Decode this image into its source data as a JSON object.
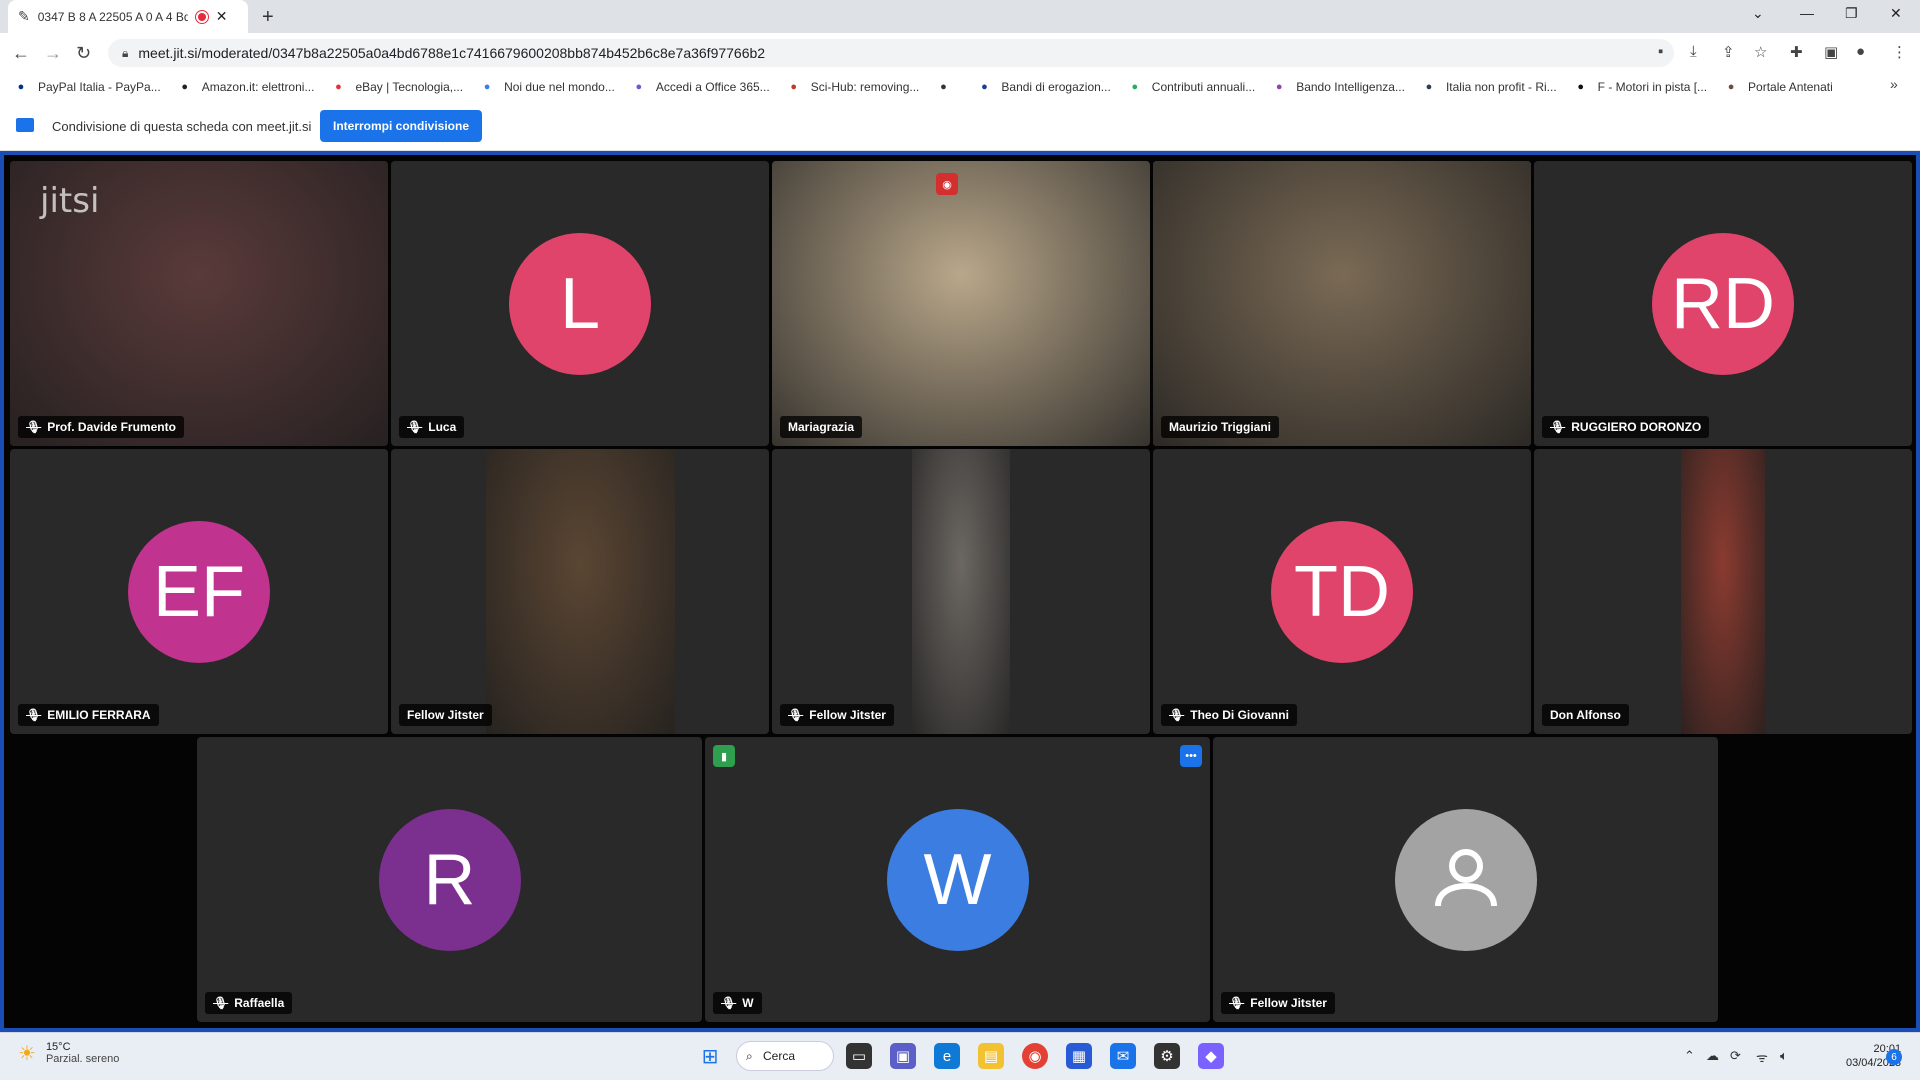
{
  "browser": {
    "tab_title": "0347 B 8 A 22505 A 0 A 4 Bd",
    "new_tab_label": "+",
    "url": "meet.jit.si/moderated/0347b8a22505a0a4bd6788e1c7416679600208bb874b452b6c8e7a36f97766b2",
    "bookmarks": [
      {
        "label": "PayPal Italia - PayPa...",
        "icon": "paypal-icon",
        "color": "#003087"
      },
      {
        "label": "Amazon.it: elettroni...",
        "icon": "amazon-icon",
        "color": "#222"
      },
      {
        "label": "eBay | Tecnologia,...",
        "icon": "ebay-icon",
        "color": "#e53238"
      },
      {
        "label": "Noi due nel mondo...",
        "icon": "blog-icon",
        "color": "#3b7de9"
      },
      {
        "label": "Accedi a Office 365...",
        "icon": "office-icon",
        "color": "#6a5acd"
      },
      {
        "label": "Sci-Hub: removing...",
        "icon": "scihub-icon",
        "color": "#c0392b"
      },
      {
        "label": "",
        "icon": "globe-icon",
        "color": "#333"
      },
      {
        "label": "Bandi di erogazion...",
        "icon": "doc-icon",
        "color": "#1f3a93"
      },
      {
        "label": "Contributi annuali...",
        "icon": "circle-icon",
        "color": "#27ae60"
      },
      {
        "label": "Bando Intelligenza...",
        "icon": "dots-icon",
        "color": "#8e44ad"
      },
      {
        "label": "Italia non profit - Ri...",
        "icon": "star-icon",
        "color": "#2c3e50"
      },
      {
        "label": "F - Motori in pista [...",
        "icon": "flag-icon",
        "color": "#111"
      },
      {
        "label": "Portale Antenati",
        "icon": "tree-icon",
        "color": "#6d4c41"
      }
    ],
    "more_bookmarks": "»"
  },
  "share_bar": {
    "text": "Condivisione di questa scheda con meet.jit.si",
    "stop_button": "Interrompi condivisione"
  },
  "participants": [
    {
      "name": "Prof. Davide Frumento",
      "initials": "",
      "muted": true,
      "video": "#5a3a3a",
      "watermark": "jitsi"
    },
    {
      "name": "Luca",
      "initials": "L",
      "muted": true,
      "color": "#e0446a"
    },
    {
      "name": "Mariagrazia",
      "initials": "",
      "muted": false,
      "video": "#b9a78a"
    },
    {
      "name": "Maurizio Triggiani",
      "initials": "",
      "muted": false,
      "video": "#7a6a55",
      "active": true
    },
    {
      "name": "RUGGIERO DORONZO",
      "initials": "RD",
      "muted": true,
      "color": "#e0446a"
    },
    {
      "name": "EMILIO FERRARA",
      "initials": "EF",
      "muted": true,
      "color": "#c0338f"
    },
    {
      "name": "Fellow Jitster",
      "initials": "",
      "muted": false,
      "video": "#5b4633"
    },
    {
      "name": "Fellow Jitster",
      "initials": "",
      "muted": true,
      "video": "#6c6762"
    },
    {
      "name": "Theo Di Giovanni",
      "initials": "TD",
      "muted": true,
      "color": "#e0446a"
    },
    {
      "name": "Don Alfonso",
      "initials": "",
      "muted": false,
      "video": "#8a3b30"
    },
    {
      "name": "Raffaella",
      "initials": "R",
      "muted": true,
      "color": "#7b2f8e"
    },
    {
      "name": "W",
      "initials": "W",
      "muted": true,
      "color": "#3b7de0"
    },
    {
      "name": "Fellow Jitster",
      "initials": "",
      "muted": true,
      "color": "#a3a3a3",
      "generic": true
    }
  ],
  "taskbar": {
    "temperature": "15°C",
    "weather": "Parzial. sereno",
    "search": "Cerca",
    "time": "20:01",
    "date": "03/04/2023",
    "notifications": "6"
  }
}
